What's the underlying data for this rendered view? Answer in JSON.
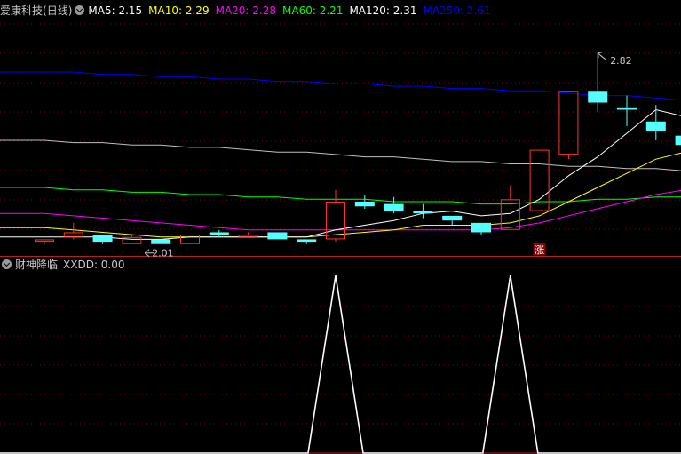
{
  "stock": {
    "name": "爱康科技",
    "period": "(日线)"
  },
  "ma_legend": [
    {
      "label": "MA5: 2.15",
      "color": "#ffffff"
    },
    {
      "label": "MA10: 2.29",
      "color": "#ffff00"
    },
    {
      "label": "MA20: 2.28",
      "color": "#ff00ff"
    },
    {
      "label": "MA60: 2.21",
      "color": "#00ff00"
    },
    {
      "label": "MA120: 2.31",
      "color": "#ffffff"
    },
    {
      "label": "MA250: 2.61",
      "color": "#0000ff"
    }
  ],
  "indicator": {
    "name": "财神降临",
    "value_label": "XXDD: 0.00"
  },
  "annotations": {
    "high_label": "2.82",
    "low_label": "2.01",
    "limit_up_badge": "涨"
  },
  "colors": {
    "up": "#ff3232",
    "down": "#54ffff",
    "grid": "#8b0000",
    "frame": "#b22222",
    "ma5": "#ffffff",
    "ma10": "#ffff00",
    "ma20": "#ff00ff",
    "ma60": "#00ff00",
    "ma120": "#c0c0c0",
    "ma250": "#0000ff"
  },
  "chart_data": [
    {
      "type": "candlestick",
      "x": [
        1,
        2,
        3,
        4,
        5,
        6,
        7,
        8,
        9,
        10,
        11,
        12,
        13,
        14,
        15,
        16,
        17,
        18,
        19,
        20,
        21,
        22,
        23
      ],
      "candles": [
        {
          "o": 2.02,
          "h": 2.03,
          "l": 2.01,
          "c": 2.03
        },
        {
          "o": 2.04,
          "h": 2.1,
          "l": 2.03,
          "c": 2.06
        },
        {
          "o": 2.05,
          "h": 2.05,
          "l": 2.01,
          "c": 2.02
        },
        {
          "o": 2.01,
          "h": 2.05,
          "l": 2.01,
          "c": 2.04
        },
        {
          "o": 2.03,
          "h": 2.03,
          "l": 2.01,
          "c": 2.01
        },
        {
          "o": 2.01,
          "h": 2.05,
          "l": 2.01,
          "c": 2.05
        },
        {
          "o": 2.06,
          "h": 2.07,
          "l": 2.04,
          "c": 2.05
        },
        {
          "o": 2.04,
          "h": 2.06,
          "l": 2.04,
          "c": 2.05
        },
        {
          "o": 2.06,
          "h": 2.06,
          "l": 2.03,
          "c": 2.03
        },
        {
          "o": 2.03,
          "h": 2.03,
          "l": 2.01,
          "c": 2.02
        },
        {
          "o": 2.03,
          "h": 2.24,
          "l": 2.02,
          "c": 2.19
        },
        {
          "o": 2.19,
          "h": 2.22,
          "l": 2.16,
          "c": 2.17
        },
        {
          "o": 2.18,
          "h": 2.21,
          "l": 2.14,
          "c": 2.15
        },
        {
          "o": 2.15,
          "h": 2.18,
          "l": 2.12,
          "c": 2.14
        },
        {
          "o": 2.13,
          "h": 2.13,
          "l": 2.09,
          "c": 2.11
        },
        {
          "o": 2.1,
          "h": 2.1,
          "l": 2.05,
          "c": 2.06
        },
        {
          "o": 2.07,
          "h": 2.26,
          "l": 2.07,
          "c": 2.2
        },
        {
          "o": 2.15,
          "h": 2.41,
          "l": 2.15,
          "c": 2.41
        },
        {
          "o": 2.39,
          "h": 2.66,
          "l": 2.37,
          "c": 2.66
        },
        {
          "o": 2.66,
          "h": 2.82,
          "l": 2.57,
          "c": 2.61
        },
        {
          "o": 2.59,
          "h": 2.64,
          "l": 2.51,
          "c": 2.58
        },
        {
          "o": 2.53,
          "h": 2.6,
          "l": 2.45,
          "c": 2.49
        },
        {
          "o": 2.47,
          "h": 2.53,
          "l": 2.4,
          "c": 2.43
        }
      ],
      "ma5": [
        2.04,
        2.04,
        2.04,
        2.03,
        2.03,
        2.04,
        2.04,
        2.04,
        2.04,
        2.04,
        2.07,
        2.09,
        2.11,
        2.14,
        2.15,
        2.13,
        2.14,
        2.2,
        2.3,
        2.38,
        2.48,
        2.58,
        2.55
      ],
      "ma10": [
        2.08,
        2.07,
        2.06,
        2.05,
        2.04,
        2.04,
        2.04,
        2.04,
        2.04,
        2.04,
        2.05,
        2.06,
        2.07,
        2.09,
        2.09,
        2.09,
        2.1,
        2.13,
        2.19,
        2.25,
        2.31,
        2.37,
        2.4
      ],
      "ma20": [
        2.14,
        2.13,
        2.12,
        2.11,
        2.1,
        2.09,
        2.08,
        2.07,
        2.07,
        2.07,
        2.07,
        2.07,
        2.07,
        2.07,
        2.07,
        2.07,
        2.08,
        2.1,
        2.13,
        2.16,
        2.19,
        2.22,
        2.24
      ],
      "ma60": [
        2.25,
        2.24,
        2.24,
        2.23,
        2.23,
        2.22,
        2.22,
        2.21,
        2.21,
        2.2,
        2.2,
        2.2,
        2.19,
        2.19,
        2.19,
        2.18,
        2.18,
        2.19,
        2.19,
        2.2,
        2.2,
        2.21,
        2.21
      ],
      "ma120": [
        2.45,
        2.44,
        2.44,
        2.43,
        2.43,
        2.42,
        2.42,
        2.41,
        2.4,
        2.4,
        2.39,
        2.38,
        2.38,
        2.37,
        2.36,
        2.36,
        2.35,
        2.35,
        2.34,
        2.34,
        2.33,
        2.33,
        2.32
      ],
      "ma250": [
        2.74,
        2.74,
        2.73,
        2.73,
        2.72,
        2.72,
        2.71,
        2.71,
        2.7,
        2.7,
        2.69,
        2.69,
        2.68,
        2.68,
        2.67,
        2.67,
        2.66,
        2.66,
        2.65,
        2.64,
        2.64,
        2.63,
        2.62
      ],
      "ylim": [
        1.96,
        2.97
      ]
    },
    {
      "type": "line",
      "name": "XXDD",
      "x": [
        1,
        2,
        3,
        4,
        5,
        6,
        7,
        8,
        9,
        10,
        11,
        12,
        13,
        14,
        15,
        16,
        17,
        18,
        19,
        20,
        21,
        22,
        23
      ],
      "values": [
        0,
        0,
        0,
        0,
        0,
        0,
        0,
        0,
        0,
        0,
        1,
        0,
        0,
        0,
        0,
        0,
        1,
        0,
        0,
        0,
        0,
        0,
        0
      ],
      "ylim": [
        0,
        1
      ]
    }
  ]
}
